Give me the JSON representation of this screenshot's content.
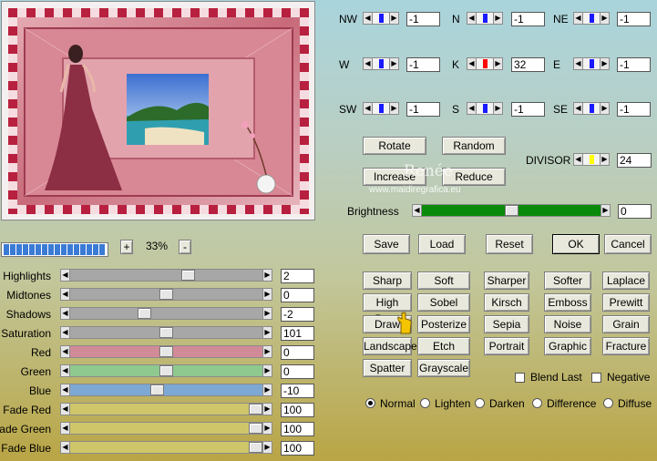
{
  "zoom": {
    "value": "33%",
    "plus": "+",
    "minus": "-"
  },
  "direction": [
    {
      "key": "nw",
      "label": "NW",
      "value": "-1"
    },
    {
      "key": "n",
      "label": "N",
      "value": "-1"
    },
    {
      "key": "ne",
      "label": "NE",
      "value": "-1"
    },
    {
      "key": "w",
      "label": "W",
      "value": "-1"
    },
    {
      "key": "k",
      "label": "K",
      "value": "32"
    },
    {
      "key": "e",
      "label": "E",
      "value": "-1"
    },
    {
      "key": "sw",
      "label": "SW",
      "value": "-1"
    },
    {
      "key": "s",
      "label": "S",
      "value": "-1"
    },
    {
      "key": "se",
      "label": "SE",
      "value": "-1"
    }
  ],
  "buttons": {
    "rotate": "Rotate",
    "random": "Random",
    "increase": "Increase",
    "reduce": "Reduce",
    "save": "Save",
    "load": "Load",
    "reset": "Reset",
    "ok": "OK",
    "cancel": "Cancel"
  },
  "divisor": {
    "label": "DIVISOR",
    "value": "24"
  },
  "brightness": {
    "label": "Brightness",
    "value": "0",
    "level": 0.5
  },
  "adjust": [
    {
      "label": "Highlights",
      "value": "2",
      "level": 0.62,
      "color": "#a7a7a7"
    },
    {
      "label": "Midtones",
      "value": "0",
      "level": 0.5,
      "color": "#a7a7a7"
    },
    {
      "label": "Shadows",
      "value": "-2",
      "level": 0.38,
      "color": "#a7a7a7"
    },
    {
      "label": "Saturation",
      "value": "101",
      "level": 0.5,
      "color": "#a7a7a7"
    },
    {
      "label": "Red",
      "value": "0",
      "level": 0.5,
      "color": "#d18b98"
    },
    {
      "label": "Green",
      "value": "0",
      "level": 0.5,
      "color": "#8fc98f"
    },
    {
      "label": "Blue",
      "value": "-10",
      "level": 0.45,
      "color": "#7ea8d4"
    },
    {
      "label": "Fade Red",
      "value": "100",
      "level": 1.0,
      "color": "#cfc66a"
    },
    {
      "label": "Fade Green",
      "value": "100",
      "level": 1.0,
      "color": "#cfc66a"
    },
    {
      "label": "Fade Blue",
      "value": "100",
      "level": 1.0,
      "color": "#cfc66a"
    }
  ],
  "filters": [
    [
      "Sharp",
      "Soft",
      "Sharper",
      "Softer",
      "Laplace"
    ],
    [
      "High Pass",
      "Sobel",
      "Kirsch",
      "Emboss",
      "Prewitt"
    ],
    [
      "Draw",
      "Posterize",
      "Sepia",
      "Noise",
      "Grain"
    ],
    [
      "Landscape",
      "Etch",
      "Portrait",
      "Graphic",
      "Fracture"
    ],
    [
      "Spatter",
      "Grayscale"
    ]
  ],
  "options": {
    "blend_last": "Blend Last",
    "negative": "Negative"
  },
  "blend_modes": [
    "Normal",
    "Lighten",
    "Darken",
    "Difference",
    "Diffuse"
  ],
  "selected_blend": "Normal",
  "watermark": {
    "line1": "Renée",
    "line2": "www.maidiregrafica.eu"
  },
  "progress": {
    "filled_segments": 16,
    "total_segments": 16
  },
  "colors": {
    "accent_blue": "#1a1aff",
    "k_red": "#ff0000",
    "divisor_yellow": "#ffff00",
    "brightness_green": "#0a8a0a"
  }
}
